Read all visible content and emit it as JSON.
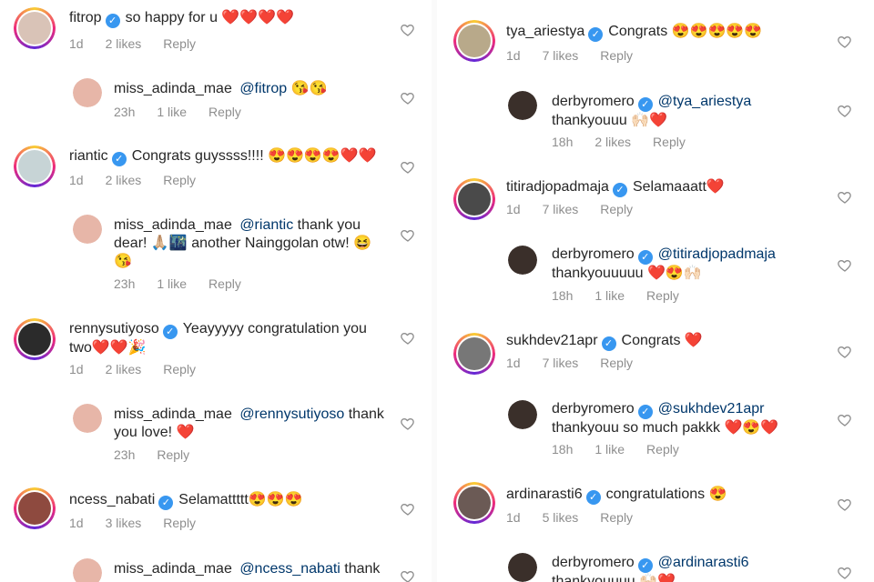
{
  "left": [
    {
      "user": "fitrop",
      "verified": true,
      "text": "so happy for u ❤️❤️❤️❤️",
      "time": "1d",
      "likes": "2 likes",
      "reply": "Reply",
      "indent": false,
      "avatar_color": "#d9c3b7"
    },
    {
      "user": "miss_adinda_mae",
      "verified": false,
      "mention": "@fitrop",
      "text": " 😘😘",
      "time": "23h",
      "likes": "1 like",
      "reply": "Reply",
      "indent": true,
      "avatar_color": "#e7b6a8"
    },
    {
      "user": "riantic",
      "verified": true,
      "text": "Congrats guyssss!!!! 😍😍😍😍❤️❤️",
      "time": "1d",
      "likes": "2 likes",
      "reply": "Reply",
      "indent": false,
      "avatar_color": "#c7d4d6"
    },
    {
      "user": "miss_adinda_mae",
      "verified": false,
      "mention": "@riantic",
      "text": " thank you dear! 🙏🏼🌃 another Nainggolan otw! 😆😘",
      "time": "23h",
      "likes": "1 like",
      "reply": "Reply",
      "indent": true,
      "avatar_color": "#e7b6a8"
    },
    {
      "user": "rennysutiyoso",
      "verified": true,
      "text": "Yeayyyyy congratulation you two❤️❤️🎉",
      "time": "1d",
      "likes": "2 likes",
      "reply": "Reply",
      "indent": false,
      "avatar_color": "#2b2b2b"
    },
    {
      "user": "miss_adinda_mae",
      "verified": false,
      "mention": "@rennysutiyoso",
      "text": " thank you love! ❤️",
      "time": "23h",
      "likes": "",
      "reply": "Reply",
      "indent": true,
      "avatar_color": "#e7b6a8"
    },
    {
      "user": "ncess_nabati",
      "verified": true,
      "text": "Selamattttt😍😍😍",
      "time": "1d",
      "likes": "3 likes",
      "reply": "Reply",
      "indent": false,
      "avatar_color": "#8e4a3f"
    },
    {
      "user": "miss_adinda_mae",
      "verified": false,
      "mention": "@ncess_nabati",
      "text": " thank",
      "time": "",
      "likes": "",
      "reply": "",
      "indent": true,
      "avatar_color": "#e7b6a8"
    }
  ],
  "right": [
    {
      "user": "tya_ariestya",
      "verified": true,
      "text": "Congrats 😍😍😍😍😍",
      "time": "1d",
      "likes": "7 likes",
      "reply": "Reply",
      "indent": false,
      "avatar_color": "#b8a98a"
    },
    {
      "user": "derbyromero",
      "verified": true,
      "mention": "@tya_ariestya",
      "text": " thankyouuu 🙌🏻❤️",
      "time": "18h",
      "likes": "2 likes",
      "reply": "Reply",
      "indent": true,
      "avatar_color": "#3a2f2a"
    },
    {
      "user": "titiradjopadmaja",
      "verified": true,
      "text": "Selamaaatt❤️",
      "time": "1d",
      "likes": "7 likes",
      "reply": "Reply",
      "indent": false,
      "avatar_color": "#4a4a4a"
    },
    {
      "user": "derbyromero",
      "verified": true,
      "mention": "@titiradjopadmaja",
      "text": " thankyouuuuu ❤️😍🙌🏻",
      "time": "18h",
      "likes": "1 like",
      "reply": "Reply",
      "indent": true,
      "avatar_color": "#3a2f2a"
    },
    {
      "user": "sukhdev21apr",
      "verified": true,
      "text": "Congrats ❤️",
      "time": "1d",
      "likes": "7 likes",
      "reply": "Reply",
      "indent": false,
      "avatar_color": "#777777"
    },
    {
      "user": "derbyromero",
      "verified": true,
      "mention": "@sukhdev21apr",
      "text": " thankyouu so much pakkk ❤️😍❤️",
      "time": "18h",
      "likes": "1 like",
      "reply": "Reply",
      "indent": true,
      "avatar_color": "#3a2f2a"
    },
    {
      "user": "ardinarasti6",
      "verified": true,
      "text": "congratulations 😍",
      "time": "1d",
      "likes": "5 likes",
      "reply": "Reply",
      "indent": false,
      "avatar_color": "#6b5a55"
    },
    {
      "user": "derbyromero",
      "verified": true,
      "mention": "@ardinarasti6",
      "text": " thankyouuuu 🙌🏻❤️",
      "time": "",
      "likes": "",
      "reply": "",
      "indent": true,
      "avatar_color": "#3a2f2a"
    }
  ],
  "icons": {
    "heart": "heart-outline-icon",
    "verified": "verified-badge-icon"
  }
}
